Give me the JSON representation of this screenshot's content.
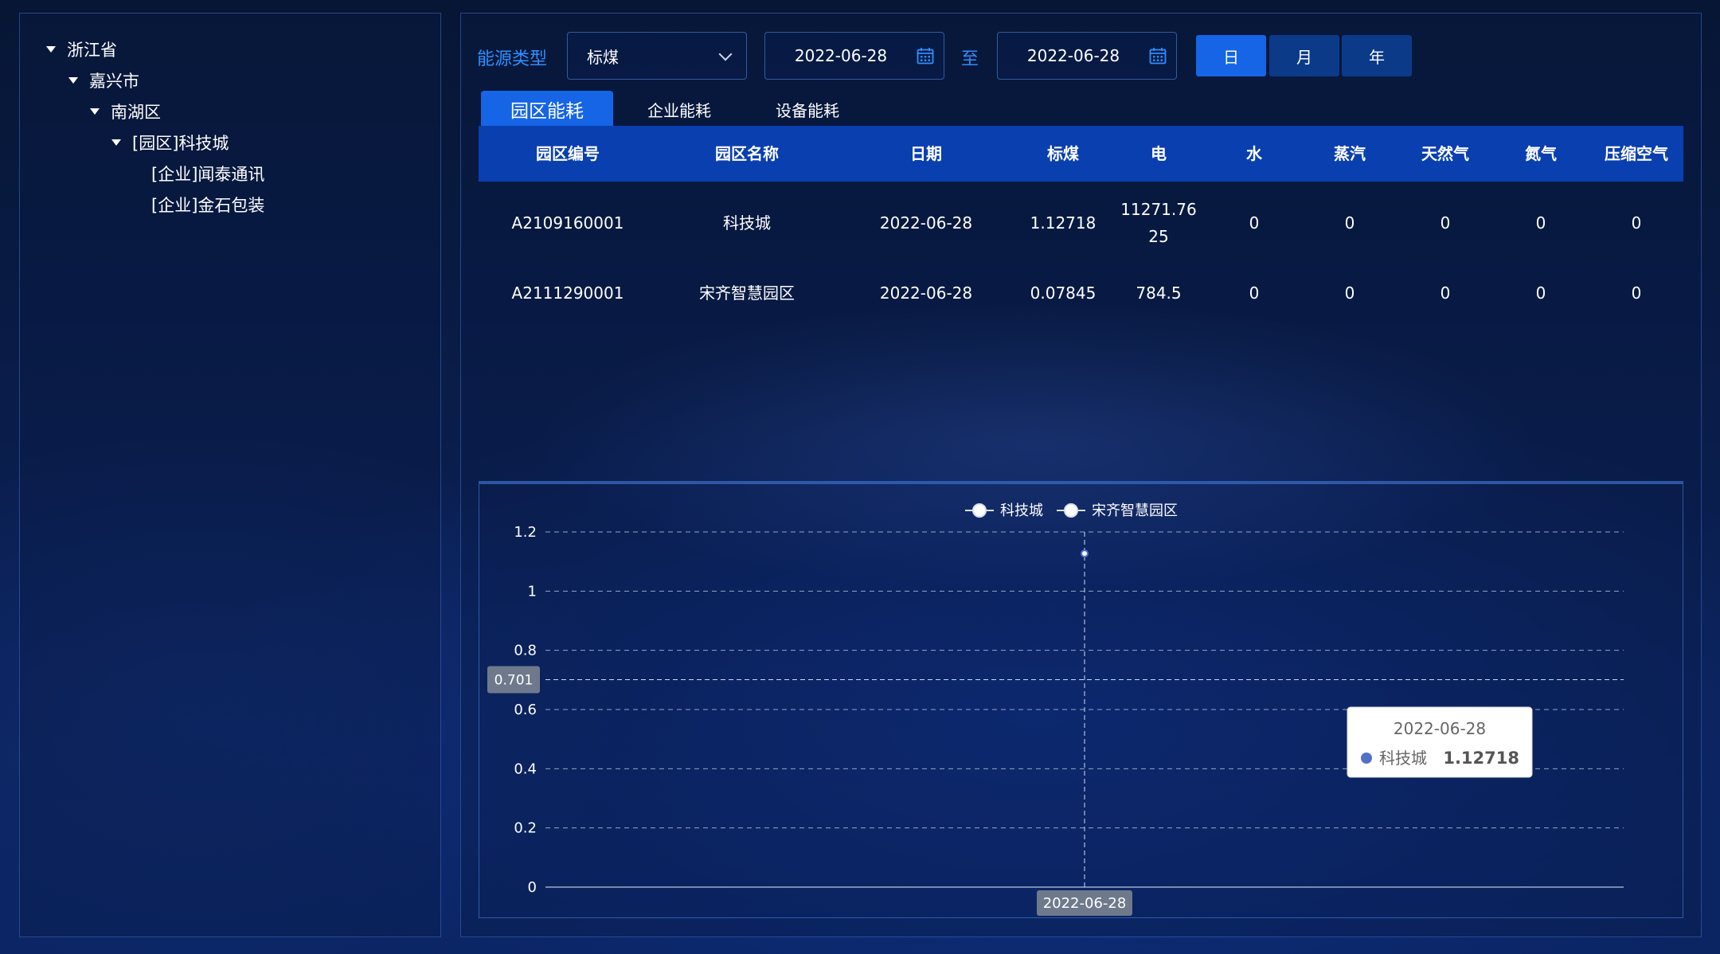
{
  "tree": {
    "province": "浙江省",
    "city": "嘉兴市",
    "district": "南湖区",
    "park": "[园区]科技城",
    "companies": [
      "[企业]闻泰通讯",
      "[企业]金石包装"
    ]
  },
  "filters": {
    "energy_type_label": "能源类型",
    "energy_type_value": "标煤",
    "date_from": "2022-06-28",
    "to_label": "至",
    "date_to": "2022-06-28",
    "periods": [
      "日",
      "月",
      "年"
    ],
    "active_period": "日"
  },
  "tabs": [
    "园区能耗",
    "企业能耗",
    "设备能耗"
  ],
  "active_tab": "园区能耗",
  "table": {
    "columns": [
      "园区编号",
      "园区名称",
      "日期",
      "标煤",
      "电",
      "水",
      "蒸汽",
      "天然气",
      "氮气",
      "压缩空气"
    ],
    "rows": [
      [
        "A2109160001",
        "科技城",
        "2022-06-28",
        "1.12718",
        "11271.7625",
        "0",
        "0",
        "0",
        "0",
        "0"
      ],
      [
        "A2111290001",
        "宋齐智慧园区",
        "2022-06-28",
        "0.07845",
        "784.5",
        "0",
        "0",
        "0",
        "0",
        "0"
      ]
    ],
    "row0_elec_line1": "11271.76",
    "row0_elec_line2": "25"
  },
  "chart_data": {
    "type": "line",
    "x": [
      "2022-06-28"
    ],
    "series": [
      {
        "name": "科技城",
        "values": [
          1.12718
        ]
      },
      {
        "name": "宋齐智慧园区",
        "values": [
          null
        ]
      }
    ],
    "ylim": [
      0,
      1.2
    ],
    "yticks": [
      "1.2",
      "1",
      "0.8",
      "0.6",
      "0.4",
      "0.2",
      "0"
    ],
    "legend": "top-center",
    "grid": true,
    "crosshair_y_label": "0.701",
    "crosshair_x_label": "2022-06-28",
    "tooltip": {
      "title": "2022-06-28",
      "series": "科技城",
      "value": "1.12718"
    },
    "colors": {
      "series_dot": "#5470c6",
      "grid": "#b8c6e0",
      "axis_text": "#ffffff"
    }
  },
  "colors": {
    "accent": "#1565e6",
    "label_blue": "#2e8fff",
    "header_bg": "#0a3fb0"
  }
}
